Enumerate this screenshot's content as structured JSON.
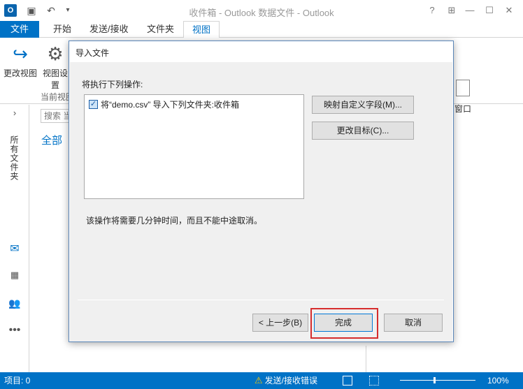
{
  "window": {
    "title": "收件箱 - Outlook 数据文件 - Outlook",
    "controls": {
      "help": "?",
      "ribbon": "⊞",
      "minimize": "—",
      "restore": "☐",
      "close": "✕"
    }
  },
  "quick_access": {
    "logo": "O",
    "save_icon": "floppy-icon",
    "undo_icon": "undo-icon",
    "more": "▾"
  },
  "tabs": [
    "文件",
    "开始",
    "发送/接收",
    "文件夹",
    "视图"
  ],
  "ribbon": {
    "change_view": "更改视图",
    "view_settings": "视图设置",
    "group_current_view": "当前视图",
    "window_label": "窗口"
  },
  "left_rail": {
    "expand": "›",
    "all_folders": "所有文件夹",
    "search_placeholder": "搜索 当",
    "filter_all": "全部"
  },
  "dialog": {
    "title": "导入文件",
    "prompt": "将执行下列操作:",
    "action_item": "将“demo.csv” 导入下列文件夹:收件箱",
    "action_checked": true,
    "map_fields_button": "映射自定义字段(M)...",
    "change_target_button": "更改目标(C)...",
    "note": "该操作将需要几分钟时间，而且不能中途取消。",
    "back_button": "< 上一步(B)",
    "finish_button": "完成",
    "cancel_button": "取消"
  },
  "statusbar": {
    "items": "项目: 0",
    "warning": "发送/接收错误",
    "zoom": "100%"
  },
  "colors": {
    "accent": "#0072c6",
    "highlight": "#d62d2d"
  }
}
